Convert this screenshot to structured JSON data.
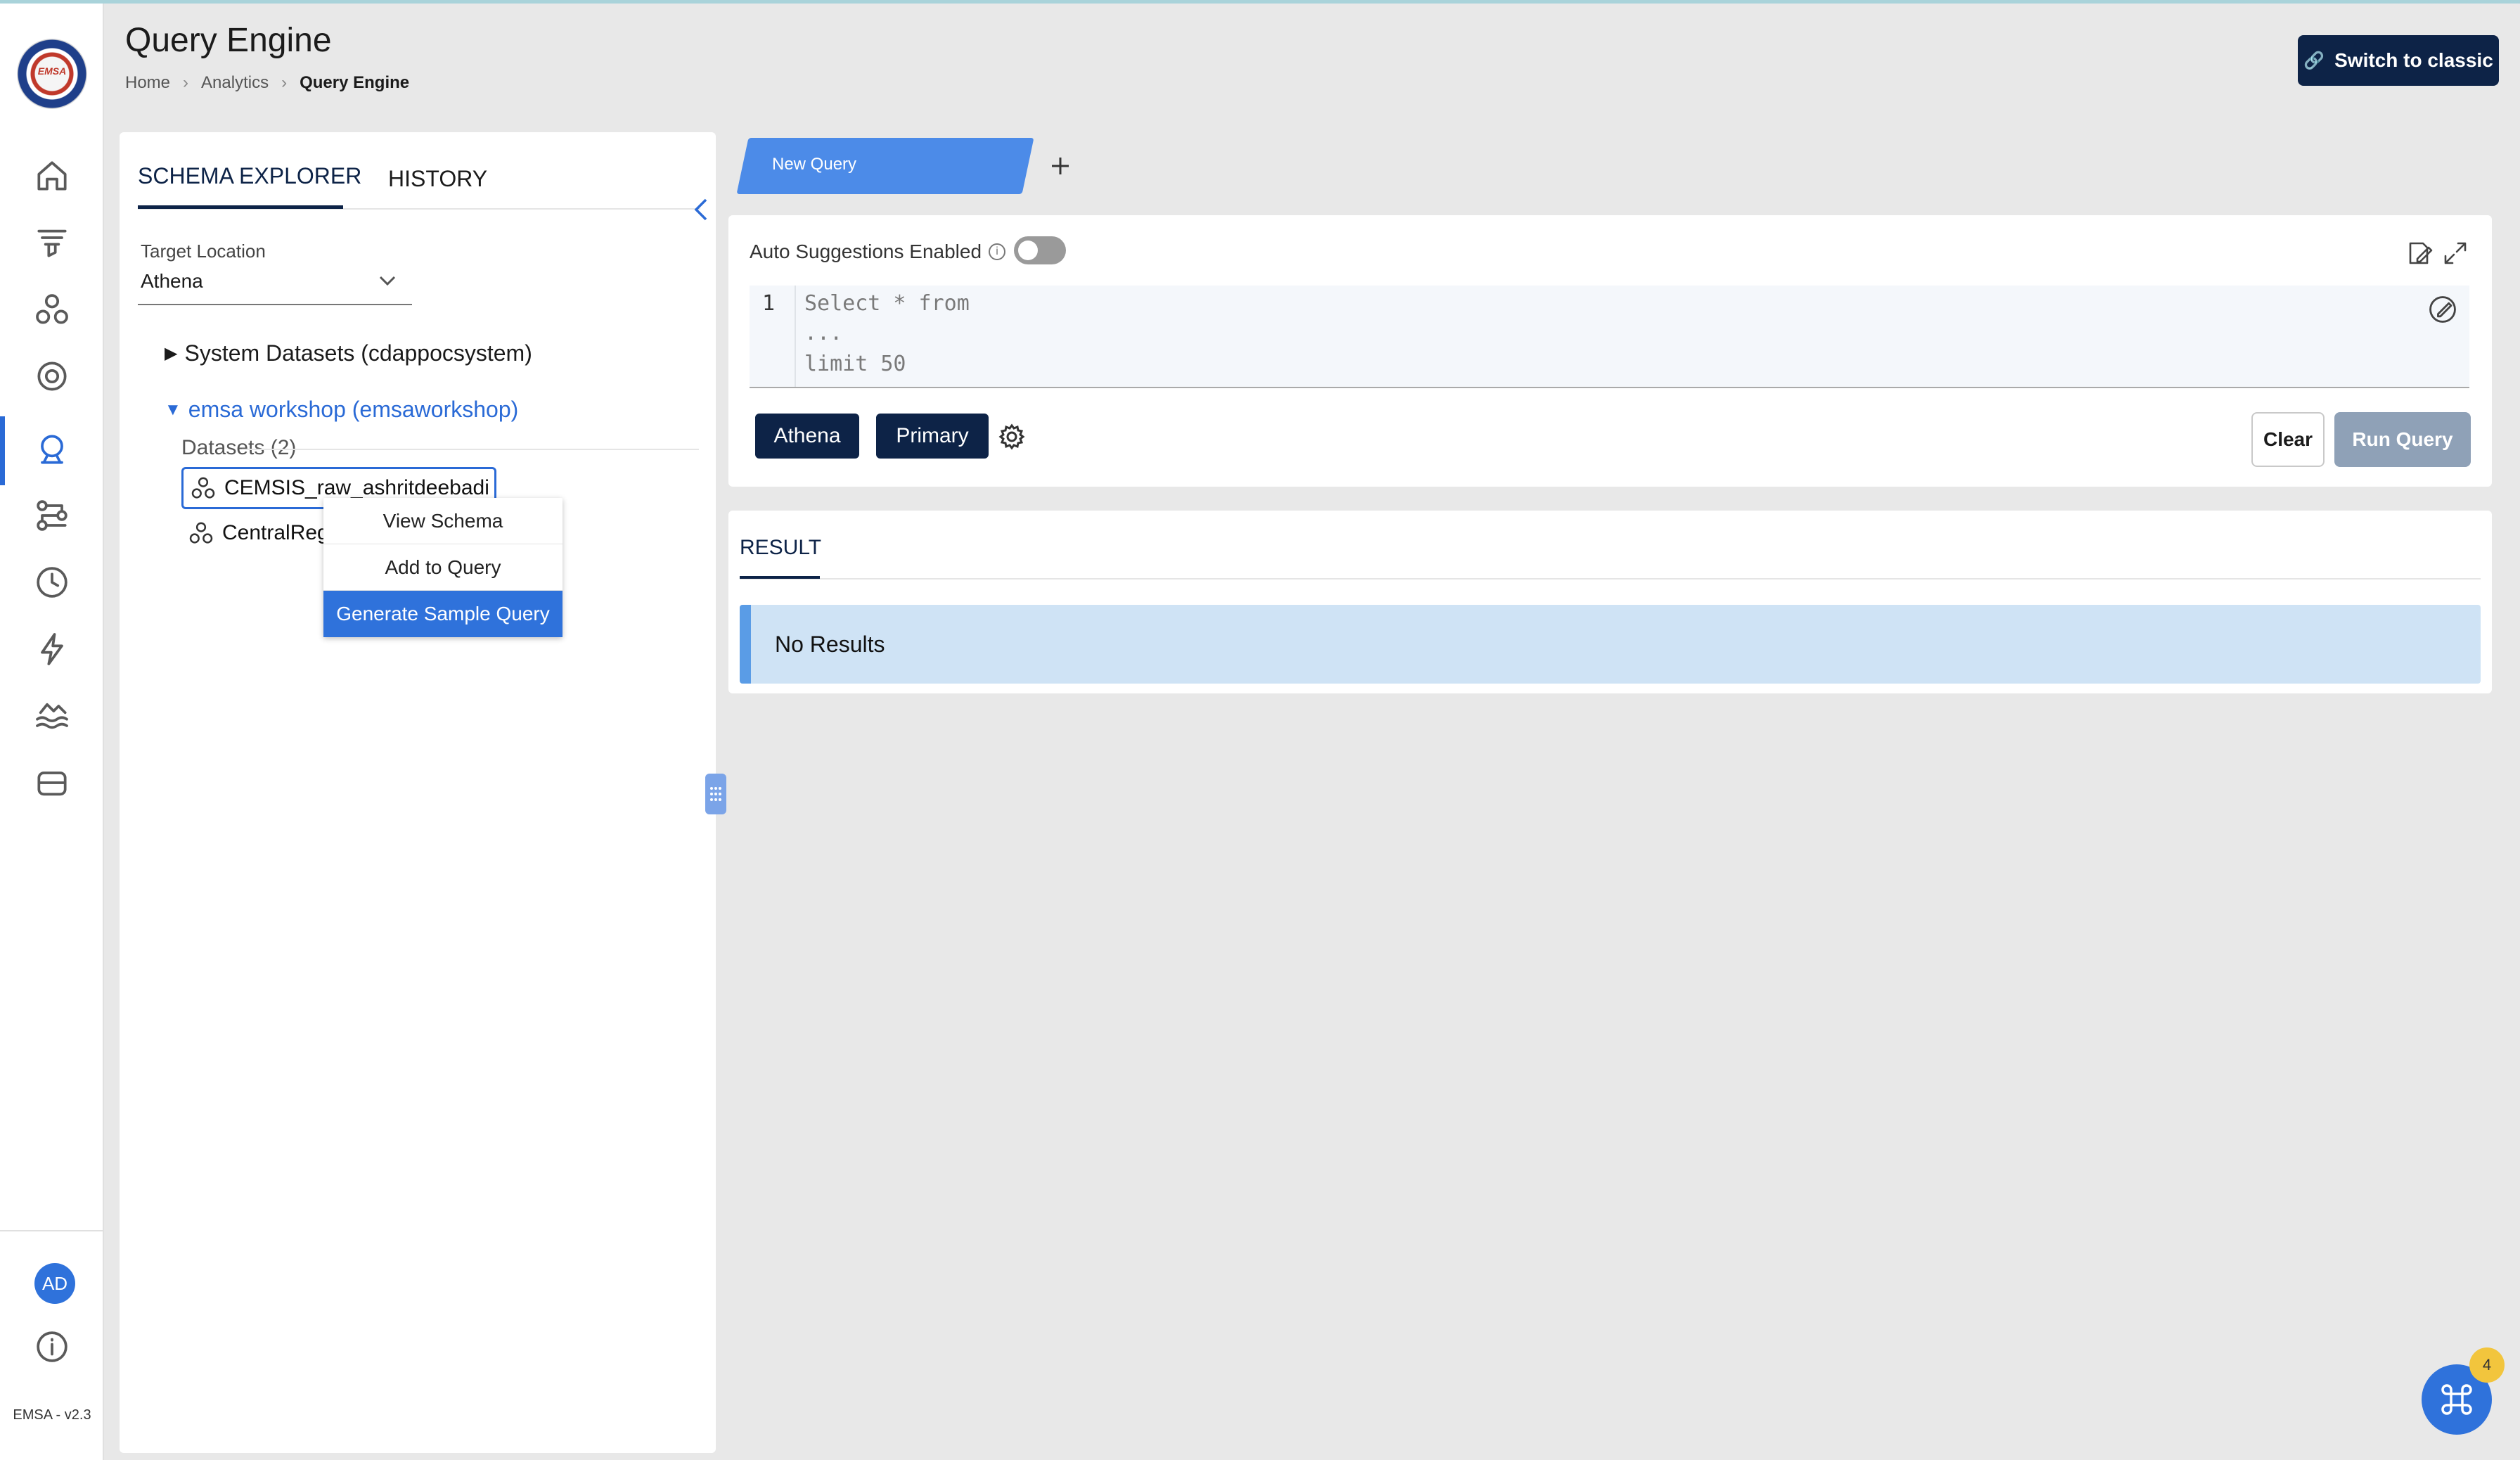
{
  "app": {
    "logo_text": "EMSA",
    "version": "EMSA - v2.3"
  },
  "header": {
    "title": "Query Engine",
    "breadcrumb": [
      "Home",
      "Analytics",
      "Query Engine"
    ],
    "switch_button": "Switch to classic"
  },
  "rail": {
    "icons": [
      "home-icon",
      "funnel-icon",
      "dataset-icon",
      "settings-circle-icon",
      "query-engine-icon",
      "pipeline-icon",
      "clock-icon",
      "lightning-icon",
      "data-lake-icon",
      "storage-icon"
    ],
    "avatar_initials": "AD",
    "accent": "#2a6ad6"
  },
  "left_panel": {
    "tabs": [
      "SCHEMA EXPLORER",
      "HISTORY"
    ],
    "target_location_label": "Target Location",
    "target_location_value": "Athena",
    "tree": {
      "system_datasets": "System Datasets (cdappocsystem)",
      "workshop": "emsa workshop (emsaworkshop)",
      "datasets_header": "Datasets (2)",
      "datasets": [
        "CEMSIS_raw_ashritdeebadi",
        "CentralRegion"
      ]
    },
    "context_menu": [
      "View Schema",
      "Add to Query",
      "Generate Sample Query"
    ]
  },
  "query": {
    "tab_label": "New Query",
    "auto_suggestions_label": "Auto Suggestions Enabled",
    "auto_suggestions_enabled": false,
    "line_number": "1",
    "code_lines": [
      "Select * from",
      "...",
      "limit 50"
    ],
    "engine_chip": "Athena",
    "workgroup_chip": "Primary",
    "clear_button": "Clear",
    "run_button": "Run Query"
  },
  "result": {
    "tab_label": "RESULT",
    "message": "No Results"
  },
  "fab": {
    "badge_count": "4"
  },
  "colors": {
    "navy": "#0d2347",
    "blue": "#2f72db",
    "info_bg": "#cfe3f5"
  }
}
